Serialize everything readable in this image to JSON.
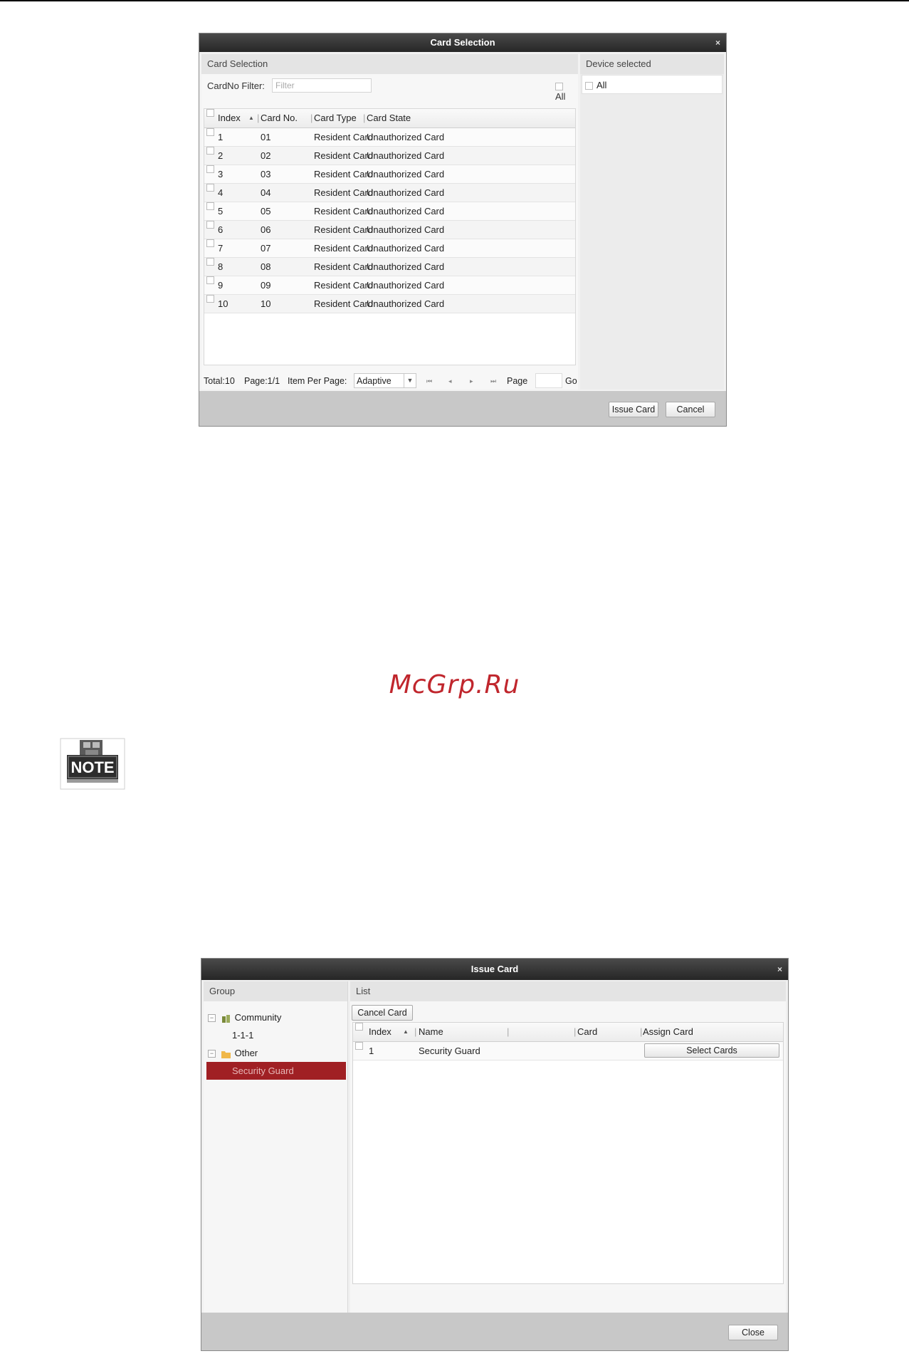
{
  "card_dialog": {
    "title": "Card Selection",
    "close_glyph": "×",
    "left_header": "Card Selection",
    "right_header": "Device selected",
    "filter_label": "CardNo Filter:",
    "filter_placeholder": "Filter",
    "all_label": "All",
    "columns": [
      "Index",
      "Card No.",
      "Card Type",
      "Card State"
    ],
    "sort_glyph": "▲",
    "rows": [
      {
        "index": "1",
        "card_no": "01",
        "type": "Resident Card",
        "state": "Unauthorized Card"
      },
      {
        "index": "2",
        "card_no": "02",
        "type": "Resident Card",
        "state": "Unauthorized Card"
      },
      {
        "index": "3",
        "card_no": "03",
        "type": "Resident Card",
        "state": "Unauthorized Card"
      },
      {
        "index": "4",
        "card_no": "04",
        "type": "Resident Card",
        "state": "Unauthorized Card"
      },
      {
        "index": "5",
        "card_no": "05",
        "type": "Resident Card",
        "state": "Unauthorized Card"
      },
      {
        "index": "6",
        "card_no": "06",
        "type": "Resident Card",
        "state": "Unauthorized Card"
      },
      {
        "index": "7",
        "card_no": "07",
        "type": "Resident Card",
        "state": "Unauthorized Card"
      },
      {
        "index": "8",
        "card_no": "08",
        "type": "Resident Card",
        "state": "Unauthorized Card"
      },
      {
        "index": "9",
        "card_no": "09",
        "type": "Resident Card",
        "state": "Unauthorized Card"
      },
      {
        "index": "10",
        "card_no": "10",
        "type": "Resident Card",
        "state": "Unauthorized Card"
      }
    ],
    "pager": {
      "total": "Total:10",
      "page": "Page:1/1",
      "items_label": "Item Per Page:",
      "items_value": "Adaptive",
      "first": "⏮",
      "prev": "◂",
      "next": "▸",
      "last": "⏭",
      "page_label": "Page",
      "go": "Go"
    },
    "device_all": "All",
    "issue_button": "Issue Card",
    "cancel_button": "Cancel"
  },
  "watermark": "McGrp.Ru",
  "note_icon": "NOTE",
  "issue_dialog": {
    "title": "Issue Card",
    "close_glyph": "×",
    "group_header": "Group",
    "list_header": "List",
    "tree": {
      "community": "Community",
      "community_child": "1-1-1",
      "other": "Other",
      "other_child": "Security Guard",
      "collapse_glyph": "−"
    },
    "cancel_card_button": "Cancel Card",
    "columns": [
      "Index",
      "Name",
      "Card",
      "Assign Card"
    ],
    "sort_glyph": "▲",
    "rows": [
      {
        "index": "1",
        "name": "Security Guard",
        "card": "",
        "assign": "Select Cards"
      }
    ],
    "close_button": "Close"
  },
  "colors": {
    "title_bar": "#2e2e2e",
    "selected_node": "#a02024",
    "watermark": "#c0262d"
  }
}
